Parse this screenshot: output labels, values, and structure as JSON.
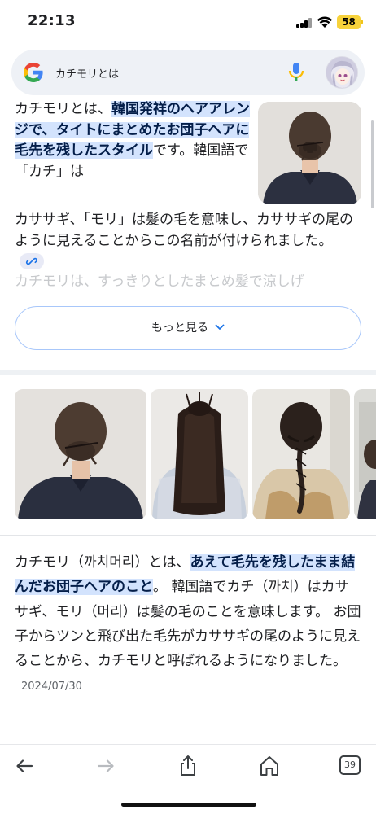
{
  "status_bar": {
    "time": "22:13",
    "battery": "58"
  },
  "search": {
    "query": "カチモリとは"
  },
  "answer": {
    "intro": "カチモリとは、",
    "highlight": "韓国発祥のヘアアレンジで、タイトにまとめたお団子ヘアに毛先を残したスタイル",
    "rest": "です。韓国語で「カチ」は",
    "tail": "カササギ、「モリ」は髪の毛を意味し、カササギの尾のように見えることからこの名前が付けられました。",
    "faded": "カチモリは、すっきりとしたまとめ髪で涼しげ",
    "more_button": "もっと見る"
  },
  "answer2": {
    "intro": "カチモリ（까치머리）とは、",
    "highlight": "あえて毛先を残したまま結んだお団子ヘアのこと",
    "rest": "。 韓国語でカチ（까치）はカササギ、モリ（머리）は髪の毛のことを意味します。 お団子からツンと飛び出た毛先がカササギの尾のように見えることから、カチモリと呼ばれるようになりました。",
    "date": "2024/07/30"
  },
  "toolbar": {
    "tab_count": "39"
  },
  "colors": {
    "highlight_bg": "#d3e3fd",
    "accent_blue": "#1a73e8",
    "battery": "#f7d23b"
  },
  "icons": [
    "google-logo-icon",
    "mic-icon",
    "link-icon",
    "chevron-down-icon",
    "back-arrow-icon",
    "forward-arrow-icon",
    "share-icon",
    "home-icon",
    "tabs-icon"
  ]
}
